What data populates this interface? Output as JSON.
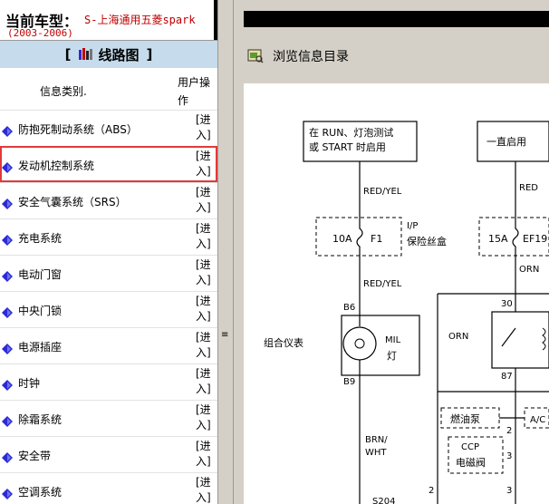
{
  "header": {
    "label": "当前车型：",
    "model": "S-上海通用五菱spark",
    "years": "(2003-2006)"
  },
  "section_title": {
    "open": "[",
    "text": "线路图",
    "close": "]"
  },
  "columns": {
    "category": "信息类别.",
    "operation": "用户操作"
  },
  "rows": [
    {
      "name": "防抱死制动系统（ABS）",
      "action": "[进入]"
    },
    {
      "name": "发动机控制系统",
      "action": "[进入]",
      "selected": true
    },
    {
      "name": "安全气囊系统（SRS）",
      "action": "[进入]"
    },
    {
      "name": "充电系统",
      "action": "[进入]"
    },
    {
      "name": "电动门窗",
      "action": "[进入]"
    },
    {
      "name": "中央门锁",
      "action": "[进入]"
    },
    {
      "name": "电源插座",
      "action": "[进入]"
    },
    {
      "name": "时钟",
      "action": "[进入]"
    },
    {
      "name": "除霜系统",
      "action": "[进入]"
    },
    {
      "name": "安全带",
      "action": "[进入]"
    },
    {
      "name": "空调系统",
      "action": "[进入]"
    }
  ],
  "splitter_grip": "≡",
  "viewer": {
    "browse_label": "浏览信息目录"
  },
  "diagram": {
    "box1": [
      "在 RUN、灯泡测试",
      "或 START 时启用"
    ],
    "box2": "一直启用",
    "wire_red_yel_1": "RED/YEL",
    "wire_red": "RED",
    "fuse_10a": "10A",
    "fuse_f1": "F1",
    "ip_label": "I/P",
    "fuse_box_label": "保险丝盒",
    "fuse_15a": "15A",
    "fuse_ef19": "EF19",
    "wire_red_yel_2": "RED/YEL",
    "wire_orn_1": "ORN",
    "pin_b6": "B6",
    "pin_30": "30",
    "cluster_label": "组合仪表",
    "mil": "MIL",
    "lamp": "灯",
    "wire_orn_2": "ORN",
    "pin_87": "87",
    "pin_b9": "B9",
    "fuel_pump": "燃油泵",
    "ac": "A/C",
    "wire_brn": "BRN/",
    "wire_wht": "WHT",
    "ccp": "CCP",
    "solenoid": "电磁阀",
    "num_2a": "2",
    "num_3a": "3",
    "num_2b": "2",
    "num_3b": "3",
    "bottom_label": "S204"
  },
  "colors": {
    "title_bg": "#c6dcec",
    "header_text": "#c00000",
    "selection": "#e23a3a",
    "icon_blue": "#2a2ad8"
  }
}
